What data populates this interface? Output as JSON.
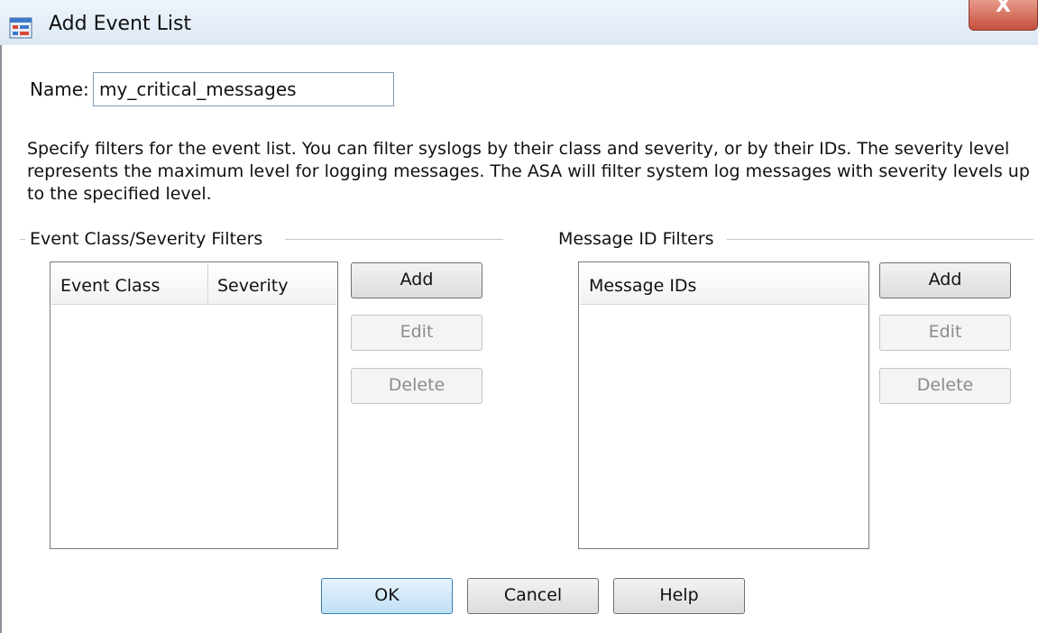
{
  "window": {
    "title": "Add Event List",
    "close_glyph": "X"
  },
  "name_field": {
    "label": "Name:",
    "value": "my_critical_messages"
  },
  "description": "Specify filters for the event list. You can filter syslogs by their class and severity, or by their IDs. The severity level represents the maximum level for logging messages. The ASA will filter system log messages with severity levels up to the specified level.",
  "class_filters": {
    "group_title": "Event Class/Severity Filters",
    "columns": [
      "Event Class",
      "Severity"
    ],
    "rows": [],
    "buttons": {
      "add": "Add",
      "edit": "Edit",
      "delete": "Delete"
    }
  },
  "id_filters": {
    "group_title": "Message ID Filters",
    "columns": [
      "Message IDs"
    ],
    "rows": [],
    "buttons": {
      "add": "Add",
      "edit": "Edit",
      "delete": "Delete"
    }
  },
  "footer": {
    "ok": "OK",
    "cancel": "Cancel",
    "help": "Help"
  },
  "icons": {
    "title": "event-list-icon",
    "close": "close-icon"
  },
  "colors": {
    "close_button": "#c64f3c",
    "primary_button": "#bfe0f5",
    "disabled_text": "#8c8c8c"
  }
}
